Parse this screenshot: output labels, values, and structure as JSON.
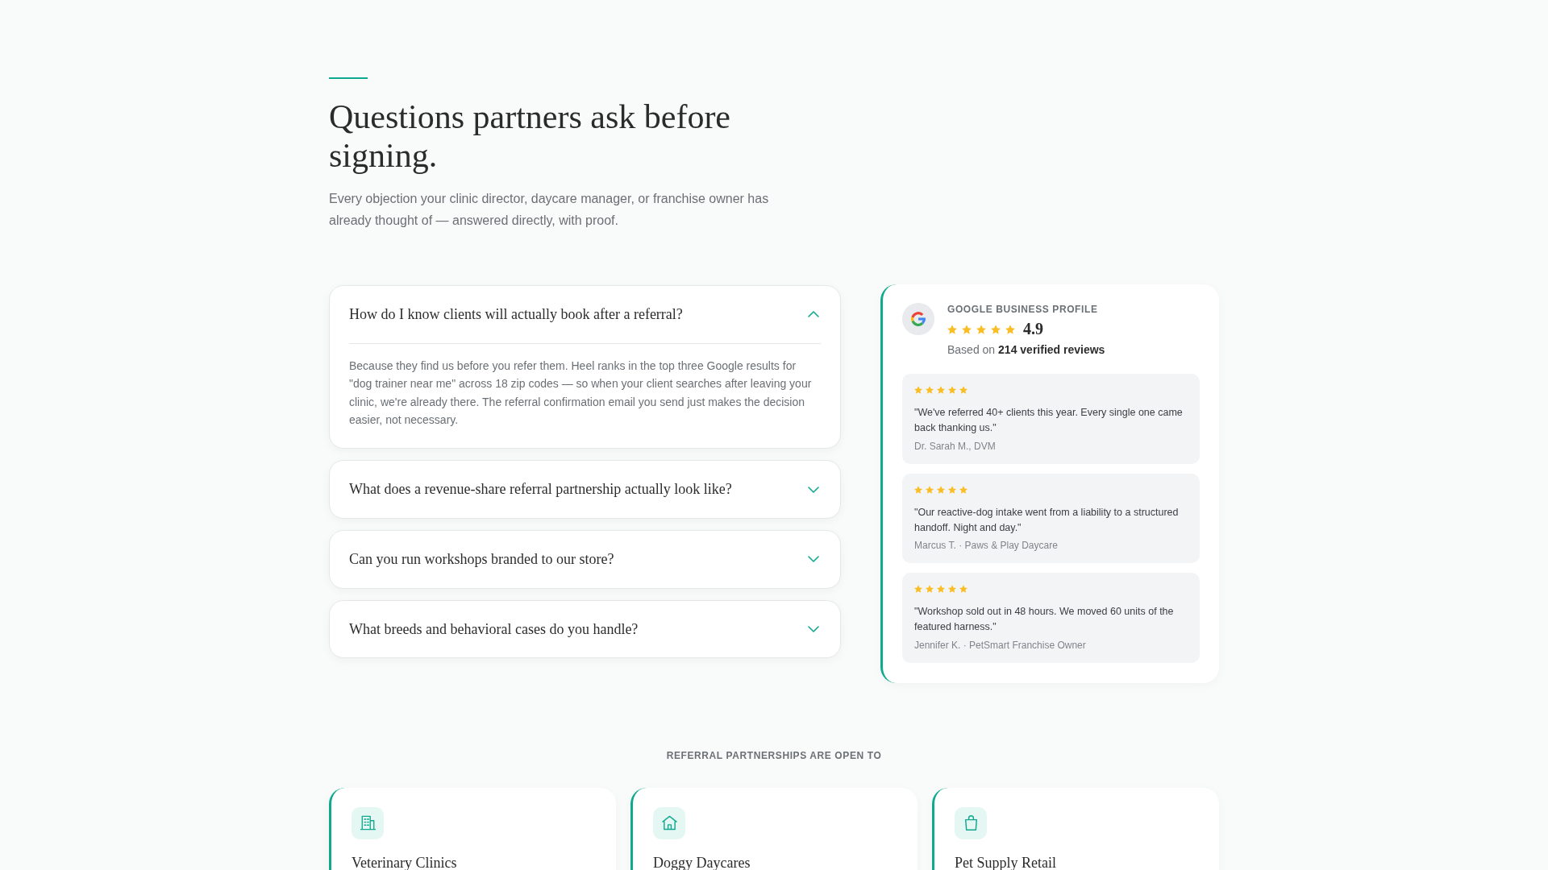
{
  "header": {
    "title": "Questions partners ask before signing.",
    "subtitle": "Every objection your clinic director, daycare manager, or franchise owner has already thought of — answered directly, with proof."
  },
  "faq": [
    {
      "question": "How do I know clients will actually book after a referral?",
      "expanded": true,
      "answer": "Because they find us before you refer them. Heel ranks in the top three Google results for \"dog trainer near me\" across 18 zip codes — so when your client searches after leaving your clinic, we're already there. The referral confirmation email you send just makes the decision easier, not necessary."
    },
    {
      "question": "What does a revenue-share referral partnership actually look like?",
      "expanded": false
    },
    {
      "question": "Can you run workshops branded to our store?",
      "expanded": false
    },
    {
      "question": "What breeds and behavioral cases do you handle?",
      "expanded": false
    }
  ],
  "reviews_card": {
    "source": "GOOGLE BUSINESS PROFILE",
    "stars": 5,
    "rating": "4.9",
    "summary": "Based on **214 verified reviews**",
    "reviews": [
      {
        "stars": 5,
        "quote": "\"We've referred 40+ clients this year. Every single one came back thanking us.\"",
        "author": "Dr. Sarah M., DVM"
      },
      {
        "stars": 5,
        "quote": "\"Our reactive-dog intake went from a liability to a structured handoff. Night and day.\"",
        "author": "Marcus T. · Paws & Play Daycare"
      },
      {
        "stars": 5,
        "quote": "\"Workshop sold out in 48 hours. We moved 60 units of the featured harness.\"",
        "author": "Jennifer K. · PetSmart Franchise Owner"
      }
    ]
  },
  "partners": {
    "heading": "REFERRAL PARTNERSHIPS ARE OPEN TO",
    "cards": [
      {
        "title": "Veterinary Clinics"
      },
      {
        "title": "Doggy Daycares"
      },
      {
        "title": "Pet Supply Retail"
      }
    ]
  }
}
